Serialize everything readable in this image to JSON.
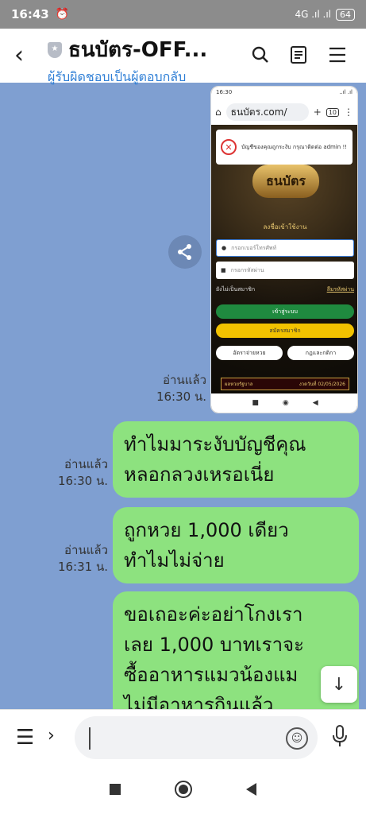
{
  "status_bar": {
    "time": "16:43",
    "alarm_icon": "alarm-icon",
    "signal": "4G .ıl .ıl",
    "battery": "64"
  },
  "header": {
    "title": "ธนบัตร-OFF...",
    "subtitle": "ผู้รับผิดชอบเป็นผู้ตอบกลับ",
    "icons": [
      "back-icon",
      "search-icon",
      "notes-icon",
      "menu-icon"
    ]
  },
  "shared_image": {
    "status_time": "16:30",
    "status_right": "..ıl .ıl",
    "url": "ธนบัตร.com/",
    "url_plus": "+",
    "url_tabs": "10",
    "alert_text": "บัญชีของคุณถูกระงับ กรุณาติดต่อ admin !!",
    "logo_text": "ธนบัตร",
    "login_heading": "ลงชื่อเข้าใช้งาน",
    "phone_placeholder": "กรอกเบอร์โทรศัพท์",
    "password_placeholder": "กรอกรหัสผ่าน",
    "not_member": "ยังไม่เป็นสมาชิก",
    "forgot_password": "ลืมรหัสผ่าน",
    "login_button": "เข้าสู่ระบบ",
    "register_button": "สมัครสมาชิก",
    "payout_rates": "อัตราจ่ายหวย",
    "rules": "กฎและกติกา",
    "banner_left": "ผลหวยรัฐบาล",
    "banner_right": "งวดวันที่ 02/05/2026"
  },
  "messages": [
    {
      "read": "อ่านแล้ว",
      "time": "16:30 น.",
      "lines": []
    },
    {
      "read": "อ่านแล้ว",
      "time": "16:30 น.",
      "lines": [
        "ทำไมมาระงับบัญชีคุณ",
        "หลอกลวงเหรอเนี่ย"
      ]
    },
    {
      "read": "อ่านแล้ว",
      "time": "16:31 น.",
      "lines": [
        "ถูกหวย 1,000 เดียว",
        "ทำไมไม่จ่าย"
      ]
    },
    {
      "read": "",
      "time": "",
      "lines": [
        "ขอเถอะค่ะอย่าโกงเรา",
        "เลย 1,000 บาทเราจะ",
        "ซื้ออาหารแมวน้องแม",
        "ไม่มีอาหารกินแล้ว"
      ]
    }
  ],
  "colors": {
    "chat_bg": "#7f9fd1",
    "bubble": "#8de27f",
    "link": "#2f7fd6"
  }
}
